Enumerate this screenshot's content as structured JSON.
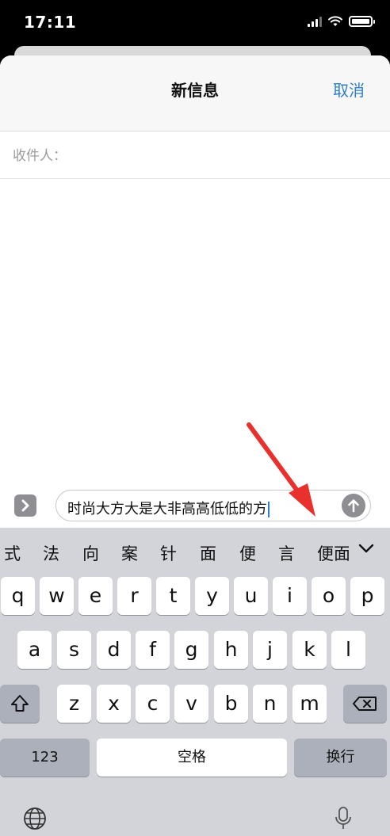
{
  "status_bar": {
    "time": "17:11"
  },
  "header": {
    "title": "新信息",
    "cancel_label": "取消"
  },
  "recipient": {
    "label": "收件人："
  },
  "compose": {
    "message_text": "时尚大方大是大非高高低低的方"
  },
  "keyboard": {
    "candidates": [
      "式",
      "法",
      "向",
      "案",
      "针",
      "面",
      "便",
      "言",
      "便面"
    ],
    "row1": [
      "q",
      "w",
      "e",
      "r",
      "t",
      "y",
      "u",
      "i",
      "o",
      "p"
    ],
    "row2": [
      "a",
      "s",
      "d",
      "f",
      "g",
      "h",
      "j",
      "k",
      "l"
    ],
    "row3": [
      "z",
      "x",
      "c",
      "v",
      "b",
      "n",
      "m"
    ],
    "numbers_label": "123",
    "space_label": "空格",
    "return_label": "换行"
  },
  "colors": {
    "accent": "#2f7fc9",
    "annotation_arrow": "#e8312c",
    "keyboard_bg": "#d2d4da"
  }
}
